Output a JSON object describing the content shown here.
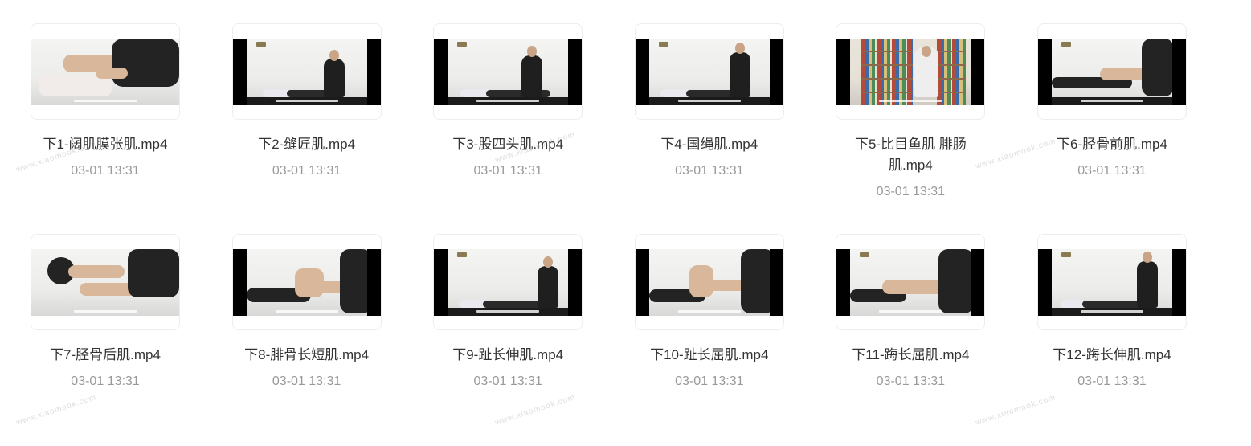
{
  "files": [
    {
      "title": "下1-阔肌膜张肌.mp4",
      "date": "03-01 13:31"
    },
    {
      "title": "下2-缝匠肌.mp4",
      "date": "03-01 13:31"
    },
    {
      "title": "下3-股四头肌.mp4",
      "date": "03-01 13:31"
    },
    {
      "title": "下4-国绳肌.mp4",
      "date": "03-01 13:31"
    },
    {
      "title": "下5-比目鱼肌 腓肠肌.mp4",
      "date": "03-01 13:31"
    },
    {
      "title": "下6-胫骨前肌.mp4",
      "date": "03-01 13:31"
    },
    {
      "title": "下7-胫骨后肌.mp4",
      "date": "03-01 13:31"
    },
    {
      "title": "下8-腓骨长短肌.mp4",
      "date": "03-01 13:31"
    },
    {
      "title": "下9-趾长伸肌.mp4",
      "date": "03-01 13:31"
    },
    {
      "title": "下10-趾长屈肌.mp4",
      "date": "03-01 13:31"
    },
    {
      "title": "下11-踇长屈肌.mp4",
      "date": "03-01 13:31"
    },
    {
      "title": "下12-踇长伸肌.mp4",
      "date": "03-01 13:31"
    }
  ],
  "watermark": "www.xiaomook.com"
}
